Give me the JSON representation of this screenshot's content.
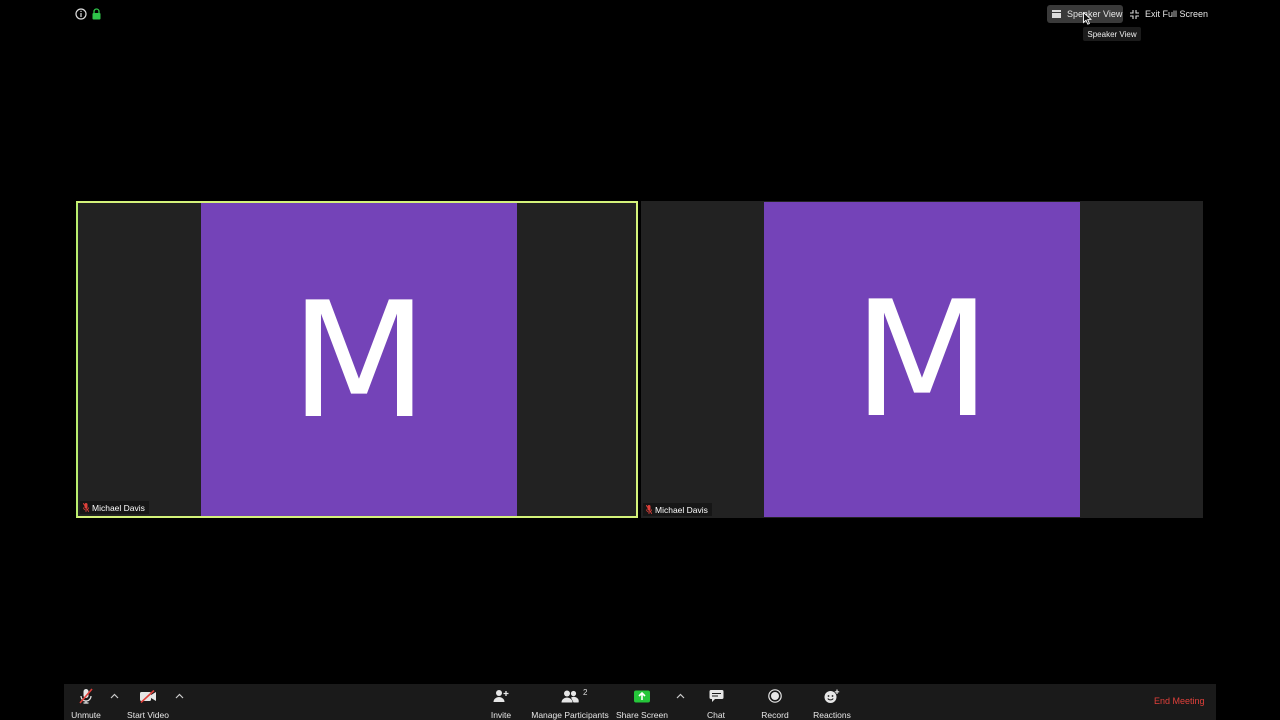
{
  "topbar": {
    "speaker_view_label": "Speaker View",
    "exit_fullscreen_label": "Exit Full Screen",
    "tooltip": "Speaker View"
  },
  "tiles": [
    {
      "initial": "M",
      "name": "Michael Davis",
      "active": true
    },
    {
      "initial": "M",
      "name": "Michael Davis",
      "active": false
    }
  ],
  "toolbar": {
    "unmute": "Unmute",
    "start_video": "Start Video",
    "invite": "Invite",
    "manage_participants": "Manage Participants",
    "participant_count": "2",
    "share_screen": "Share Screen",
    "chat": "Chat",
    "record": "Record",
    "reactions": "Reactions",
    "end_meeting": "End Meeting"
  },
  "colors": {
    "avatar": "#7443b8",
    "active_border": "#d4f27a",
    "share_green": "#25c63a",
    "end_red": "#e0403a"
  }
}
